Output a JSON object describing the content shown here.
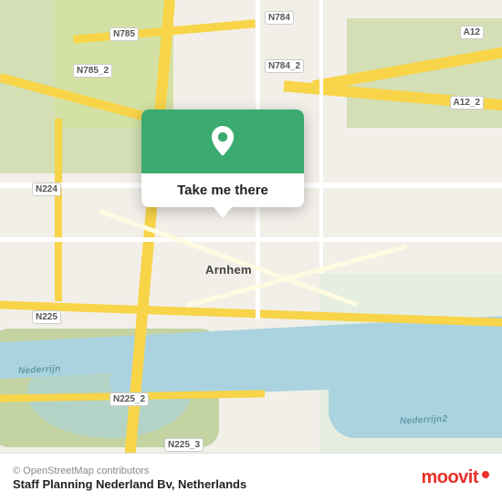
{
  "map": {
    "popup": {
      "button_label": "Take me there",
      "pin_color": "#fff"
    },
    "labels": {
      "city": "Arnhem",
      "roads": [
        "N784",
        "N785",
        "N785_2",
        "N784_2",
        "N224",
        "N225",
        "N225_2",
        "N225_3",
        "A12",
        "A12_2"
      ],
      "rivers": [
        "Nederrijn",
        "Nederrijn2"
      ]
    },
    "background_color": "#f2efe9",
    "water_color": "#aad3df",
    "green_color": "#c8d8a0"
  },
  "bottom_bar": {
    "copyright": "© OpenStreetMap contributors",
    "location": "Staff Planning Nederland Bv, Netherlands",
    "logo_text": "moovit"
  }
}
